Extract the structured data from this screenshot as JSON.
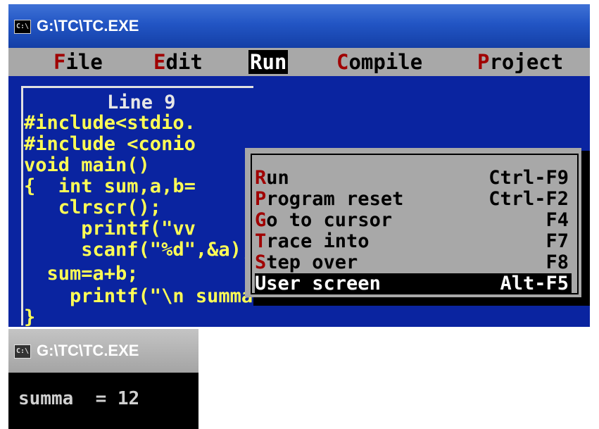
{
  "top_window": {
    "title": "G:\\TC\\TC.EXE",
    "icon": "console-icon",
    "menu": [
      {
        "hotkey": "F",
        "rest": "ile",
        "active": false
      },
      {
        "hotkey": "E",
        "rest": "dit",
        "active": false
      },
      {
        "hotkey": "R",
        "rest": "un",
        "active": true
      },
      {
        "hotkey": "C",
        "rest": "ompile",
        "active": false
      },
      {
        "hotkey": "P",
        "rest": "roject",
        "active": false
      }
    ],
    "editor": {
      "line_indicator": "Line 9",
      "code_lines": [
        "#include<stdio.",
        "#include <conio",
        "void main()",
        "{  int sum,a,b=",
        "   clrscr();",
        "     printf(\"vv",
        "     scanf(\"%d\",&a);",
        "  sum=a+b;",
        "    printf(\"\\n summa   %d= \",sum);",
        "}"
      ]
    },
    "run_menu": [
      {
        "hotkey": "R",
        "rest": "un",
        "shortcut": "Ctrl-F9",
        "selected": false
      },
      {
        "hotkey": "P",
        "rest": "rogram reset",
        "shortcut": "Ctrl-F2",
        "selected": false
      },
      {
        "hotkey": "G",
        "rest": "o to cursor",
        "shortcut": "F4",
        "selected": false
      },
      {
        "hotkey": "T",
        "rest": "race into",
        "shortcut": "F7",
        "selected": false
      },
      {
        "hotkey": "S",
        "rest": "tep over",
        "shortcut": "F8",
        "selected": false
      },
      {
        "hotkey": "U",
        "rest": "ser screen",
        "shortcut": "Alt-F5",
        "selected": true
      }
    ]
  },
  "bottom_window": {
    "title": "G:\\TC\\TC.EXE",
    "icon": "console-icon",
    "output": "summa  = 12"
  },
  "colors": {
    "editor_bg": "#0a24a0",
    "code_text": "#ffff55",
    "menu_bg": "#a8a8a8",
    "hotkey": "#a00000",
    "titlebar": "#2255c4"
  }
}
